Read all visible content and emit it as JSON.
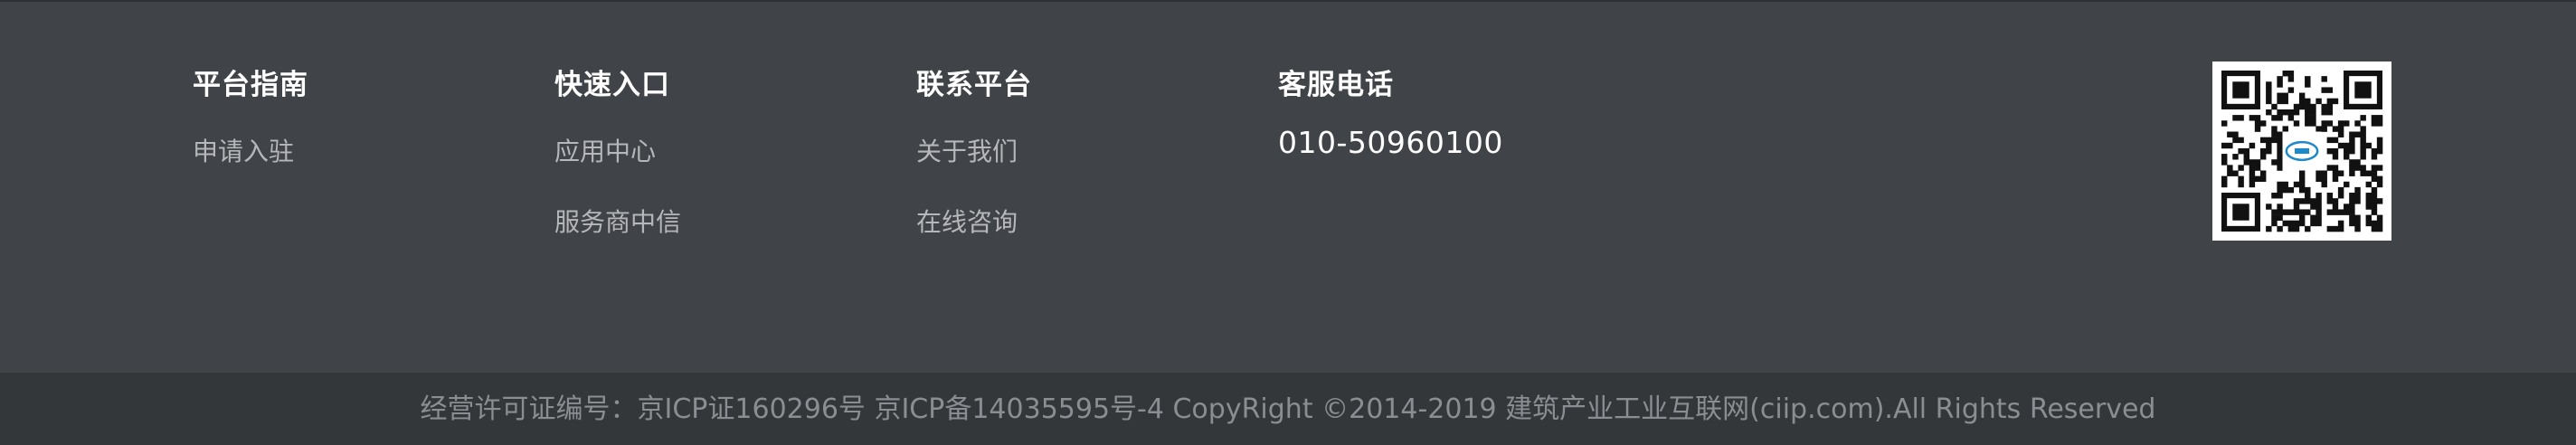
{
  "columns": [
    {
      "title": "平台指南",
      "links": [
        "申请入驻"
      ]
    },
    {
      "title": "快速入口",
      "links": [
        "应用中心",
        "服务商中信"
      ]
    },
    {
      "title": "联系平台",
      "links": [
        "关于我们",
        "在线咨询"
      ]
    },
    {
      "title": "客服电话",
      "phone": "010-50960100"
    }
  ],
  "qr_code": {
    "icon": "qr-code",
    "center_logo_icon": "ciip-logo",
    "accent_color": "#1e88c8"
  },
  "footer": {
    "copyright": "经营许可证编号：京ICP证160296号 京ICP备14035595号-4 CopyRight ©2014-2019 建筑产业工业互联网(ciip.com).All Rights Reserved"
  },
  "colors": {
    "background": "#404347",
    "bottom_bar": "#34373a",
    "title_text": "#ffffff",
    "link_text": "#b5b7ba",
    "copyright_text": "#8a8d91"
  }
}
